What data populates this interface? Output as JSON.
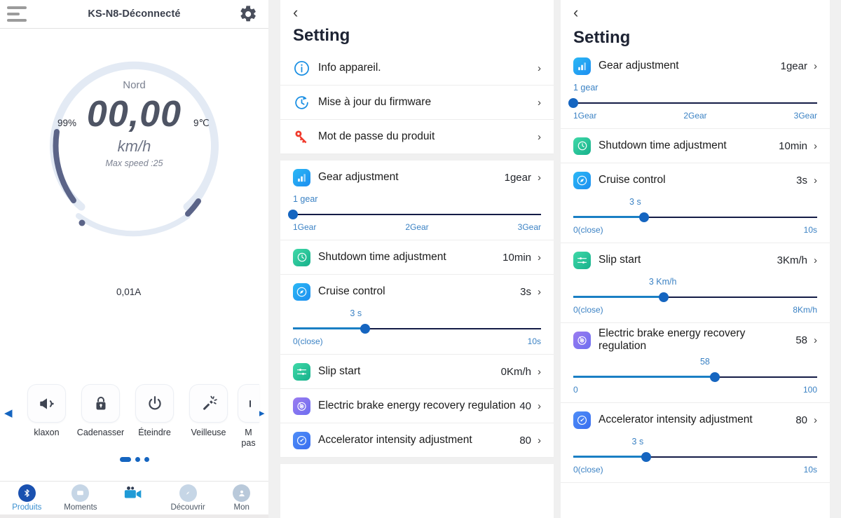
{
  "left_panel": {
    "header": {
      "title": "KS-N8-Déconnecté",
      "menu_icon": "hamburger-icon",
      "settings_icon": "gear-icon"
    },
    "gauge": {
      "battery": "99%",
      "temperature": "9℃",
      "current": "0,01A",
      "direction": "Nord",
      "speed": "00,00",
      "unit": "km/h",
      "max_speed": "Max speed :25",
      "outer_arc_color": "#5b6488",
      "inner_arc_color": "#dde5f1"
    },
    "quick_actions": {
      "prev_arrow": "◀",
      "next_arrow": "▶",
      "items": [
        {
          "label": "klaxon",
          "icon": "horn-icon"
        },
        {
          "label": "Cadenasser",
          "icon": "lock-icon"
        },
        {
          "label": "Éteindre",
          "icon": "power-icon"
        },
        {
          "label": "Veilleuse",
          "icon": "flashlight-icon"
        },
        {
          "label": "M\npas",
          "icon": "partial-icon"
        }
      ]
    },
    "tabbar": [
      {
        "label": "Produits",
        "icon": "bluetooth-icon",
        "active": true
      },
      {
        "label": "Moments",
        "icon": "chat-icon",
        "active": false
      },
      {
        "label": "",
        "icon": "video-camera-icon",
        "active": false
      },
      {
        "label": "Découvrir",
        "icon": "compass-icon",
        "active": false
      },
      {
        "label": "Mon",
        "icon": "person-icon",
        "active": false
      }
    ]
  },
  "middle_panel": {
    "back_icon": "chevron-left-icon",
    "title": "Setting",
    "rows": [
      {
        "name": "Info appareil.",
        "value": "",
        "icon": "info-circle-icon",
        "icon_style": "outline-blue",
        "chevron": "›"
      },
      {
        "name": "Mise à jour du firmware",
        "value": "",
        "icon": "firmware-update-icon",
        "icon_style": "outline-blue",
        "chevron": "›"
      },
      {
        "name": "Mot de passe du produit",
        "value": "",
        "icon": "key-icon",
        "icon_style": "outline-red",
        "chevron": "›"
      },
      {
        "name": "Gear adjustment",
        "value": "1gear",
        "icon": "bar-chart-icon",
        "icon_style": "tile-blue",
        "chevron": "›",
        "slider": {
          "current": "1 gear",
          "min_label": "1Gear",
          "mid_label": "2Gear",
          "max_label": "3Gear",
          "percent": 0
        }
      },
      {
        "name": "Shutdown time adjustment",
        "value": "10min",
        "icon": "clock-icon",
        "icon_style": "tile-green",
        "chevron": "›"
      },
      {
        "name": "Cruise control",
        "value": "3s",
        "icon": "cruise-icon",
        "icon_style": "tile-blue",
        "chevron": "›",
        "slider": {
          "current": "3 s",
          "min_label": "0(close)",
          "mid_label": "",
          "max_label": "10s",
          "percent": 29
        }
      },
      {
        "name": "Slip start",
        "value": "0Km/h",
        "icon": "slip-start-icon",
        "icon_style": "tile-green",
        "chevron": "›"
      },
      {
        "name": "Electric brake energy recovery regulation",
        "value": "40",
        "icon": "brake-recovery-icon",
        "icon_style": "tile-purple",
        "chevron": "›"
      },
      {
        "name": "Accelerator intensity adjustment",
        "value": "80",
        "icon": "accelerator-icon",
        "icon_style": "tile-indigo",
        "chevron": "›"
      }
    ]
  },
  "right_panel": {
    "back_icon": "chevron-left-icon",
    "title": "Setting",
    "rows": [
      {
        "name": "Gear adjustment",
        "value": "1gear",
        "icon": "bar-chart-icon",
        "icon_style": "tile-blue",
        "chevron": "›",
        "slider": {
          "current": "1 gear",
          "min_label": "1Gear",
          "mid_label": "2Gear",
          "max_label": "3Gear",
          "percent": 0
        }
      },
      {
        "name": "Shutdown time adjustment",
        "value": "10min",
        "icon": "clock-icon",
        "icon_style": "tile-green",
        "chevron": "›"
      },
      {
        "name": "Cruise control",
        "value": "3s",
        "icon": "cruise-icon",
        "icon_style": "tile-blue",
        "chevron": "›",
        "slider": {
          "current": "3 s",
          "min_label": "0(close)",
          "mid_label": "",
          "max_label": "10s",
          "percent": 29
        }
      },
      {
        "name": "Slip start",
        "value": "3Km/h",
        "icon": "slip-start-icon",
        "icon_style": "tile-green",
        "chevron": "›",
        "slider": {
          "current": "3 Km/h",
          "min_label": "0(close)",
          "mid_label": "",
          "max_label": "8Km/h",
          "percent": 37
        }
      },
      {
        "name": "Electric brake energy recovery regulation",
        "value": "58",
        "icon": "brake-recovery-icon",
        "icon_style": "tile-purple",
        "chevron": "›",
        "slider": {
          "current": "58",
          "min_label": "0",
          "mid_label": "",
          "max_label": "100",
          "percent": 58
        }
      },
      {
        "name": "Accelerator intensity adjustment",
        "value": "80",
        "icon": "accelerator-icon",
        "icon_style": "tile-indigo",
        "chevron": "›",
        "slider": {
          "current": "3 s",
          "min_label": "0(close)",
          "mid_label": "",
          "max_label": "10s",
          "percent": 30
        }
      }
    ]
  },
  "colors": {
    "accent_blue": "#1565c0",
    "slider_fill": "#1a7fc4",
    "slider_track": "#141c46",
    "label_blue": "#3b82c4",
    "gauge_dark": "#5b6488",
    "gauge_light": "#dde5f1"
  }
}
